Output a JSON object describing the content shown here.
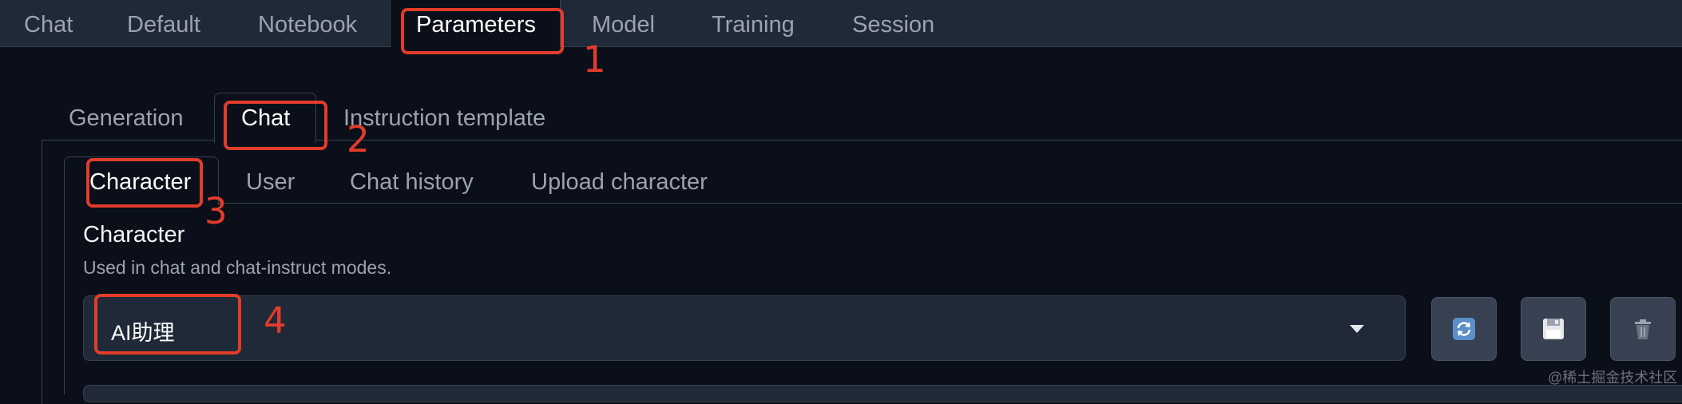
{
  "top_nav": {
    "tabs": [
      {
        "label": "Chat"
      },
      {
        "label": "Default"
      },
      {
        "label": "Notebook"
      },
      {
        "label": "Parameters",
        "active": true
      },
      {
        "label": "Model"
      },
      {
        "label": "Training"
      },
      {
        "label": "Session"
      }
    ]
  },
  "params_tabs": {
    "tabs": [
      {
        "label": "Generation"
      },
      {
        "label": "Chat",
        "active": true
      },
      {
        "label": "Instruction template"
      }
    ]
  },
  "chat_tabs": {
    "tabs": [
      {
        "label": "Character",
        "active": true
      },
      {
        "label": "User"
      },
      {
        "label": "Chat history"
      },
      {
        "label": "Upload character"
      }
    ]
  },
  "character": {
    "title": "Character",
    "info": "Used in chat and chat-instruct modes.",
    "selected": "AI助理",
    "buttons": [
      "refresh-icon",
      "save-icon",
      "delete-icon"
    ]
  },
  "annotations": {
    "numbers": [
      "1",
      "2",
      "3",
      "4"
    ],
    "color": "#e23c2b"
  },
  "watermark": "@稀土掘金技术社区",
  "colors": {
    "background": "#0b0f19",
    "topbar": "#1f2937",
    "border": "#374151",
    "button": "#374151"
  }
}
